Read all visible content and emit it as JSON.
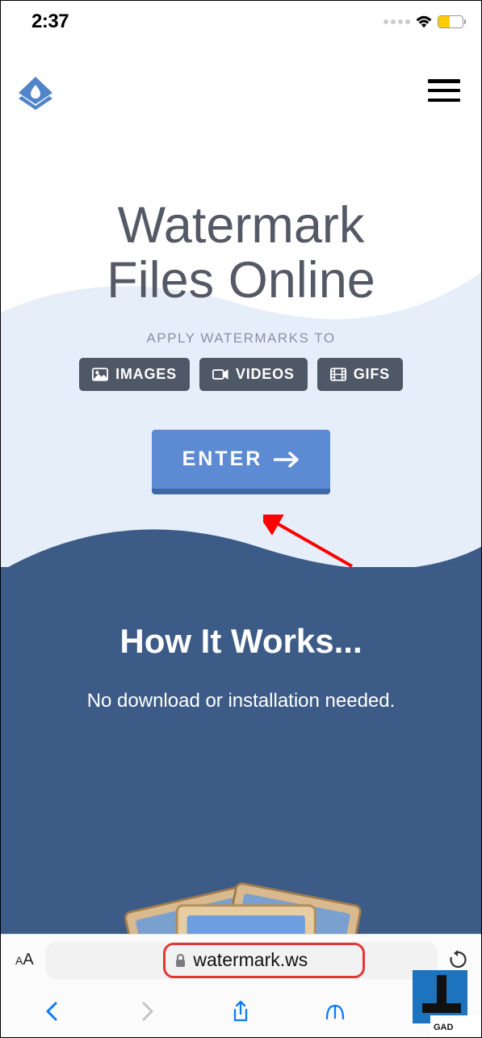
{
  "status": {
    "time": "2:37"
  },
  "hero": {
    "title_line1": "Watermark",
    "title_line2": "Files Online",
    "apply_label": "APPLY WATERMARKS TO",
    "chips": {
      "images": "IMAGES",
      "videos": "VIDEOS",
      "gifs": "GIFS"
    },
    "enter_label": "ENTER"
  },
  "how": {
    "title": "How It Works...",
    "subtitle": "No download or installation needed."
  },
  "browser": {
    "url": "watermark.ws"
  }
}
